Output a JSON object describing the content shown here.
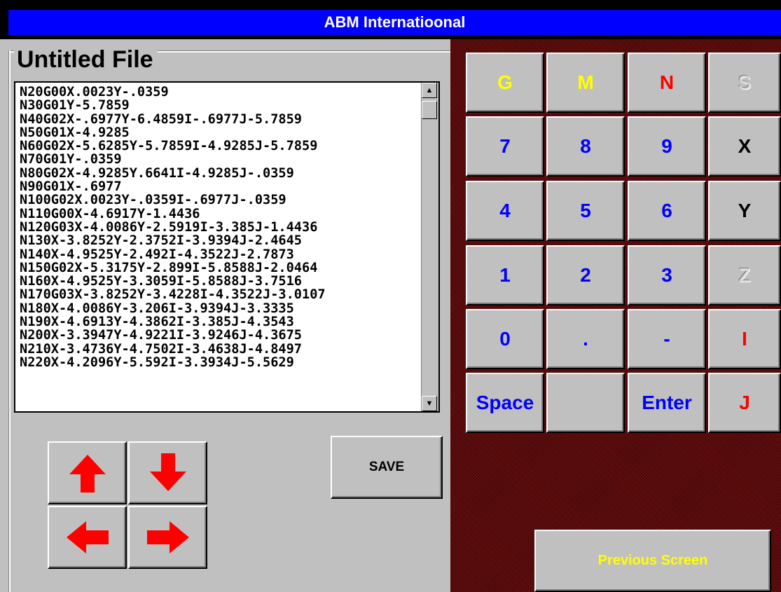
{
  "window": {
    "title": "ABM Internatioonal"
  },
  "file": {
    "title": "Untitled File"
  },
  "editor": {
    "lines": [
      "N20G00X.0023Y-.0359",
      "N30G01Y-5.7859",
      "N40G02X-.6977Y-6.4859I-.6977J-5.7859",
      "N50G01X-4.9285",
      "N60G02X-5.6285Y-5.7859I-4.9285J-5.7859",
      "N70G01Y-.0359",
      "N80G02X-4.9285Y.6641I-4.9285J-.0359",
      "N90G01X-.6977",
      "N100G02X.0023Y-.0359I-.6977J-.0359",
      "N110G00X-4.6917Y-1.4436",
      "N120G03X-4.0086Y-2.5919I-3.385J-1.4436",
      "N130X-3.8252Y-2.3752I-3.9394J-2.4645",
      "N140X-4.9525Y-2.492I-4.3522J-2.7873",
      "N150G02X-5.3175Y-2.899I-5.8588J-2.0464",
      "N160X-4.9525Y-3.3059I-5.8588J-3.7516",
      "N170G03X-3.8252Y-3.4228I-4.3522J-3.0107",
      "N180X-4.0086Y-3.206I-3.9394J-3.3335",
      "N190X-4.6913Y-4.3862I-3.385J-4.3543",
      "N200X-3.3947Y-4.9221I-3.9246J-4.3675",
      "N210X-3.4736Y-4.7502I-3.4638J-4.8497",
      "N220X-4.2096Y-5.592I-3.3934J-5.5629"
    ]
  },
  "controls": {
    "save_label": "SAVE",
    "previous_label": "Previous Screen",
    "arrows": [
      "arrow-up",
      "arrow-down",
      "arrow-left",
      "arrow-right"
    ]
  },
  "keypad": [
    {
      "label": "G",
      "color": "#ffff00"
    },
    {
      "label": "M",
      "color": "#ffff00"
    },
    {
      "label": "N",
      "color": "#ff0000"
    },
    {
      "label": "S",
      "color": "#d0d0d0"
    },
    {
      "label": "7",
      "color": "#0000ff"
    },
    {
      "label": "8",
      "color": "#0000ff"
    },
    {
      "label": "9",
      "color": "#0000ff"
    },
    {
      "label": "X",
      "color": "#000000"
    },
    {
      "label": "4",
      "color": "#0000ff"
    },
    {
      "label": "5",
      "color": "#0000ff"
    },
    {
      "label": "6",
      "color": "#0000ff"
    },
    {
      "label": "Y",
      "color": "#000000"
    },
    {
      "label": "1",
      "color": "#0000ff"
    },
    {
      "label": "2",
      "color": "#0000ff"
    },
    {
      "label": "3",
      "color": "#0000ff"
    },
    {
      "label": "Z",
      "color": "#d0d0d0"
    },
    {
      "label": "0",
      "color": "#0000ff"
    },
    {
      "label": ".",
      "color": "#0000ff"
    },
    {
      "label": "-",
      "color": "#0000ff"
    },
    {
      "label": "I",
      "color": "#ff0000"
    },
    {
      "label": "Space",
      "color": "#0000ff"
    },
    {
      "label": "",
      "color": "#0000ff"
    },
    {
      "label": "Enter",
      "color": "#0000ff"
    },
    {
      "label": "J",
      "color": "#ff0000"
    }
  ],
  "colors": {
    "titlebar": "#0000ff",
    "arrow": "#ff0000",
    "panel": "#c0c0c0"
  }
}
